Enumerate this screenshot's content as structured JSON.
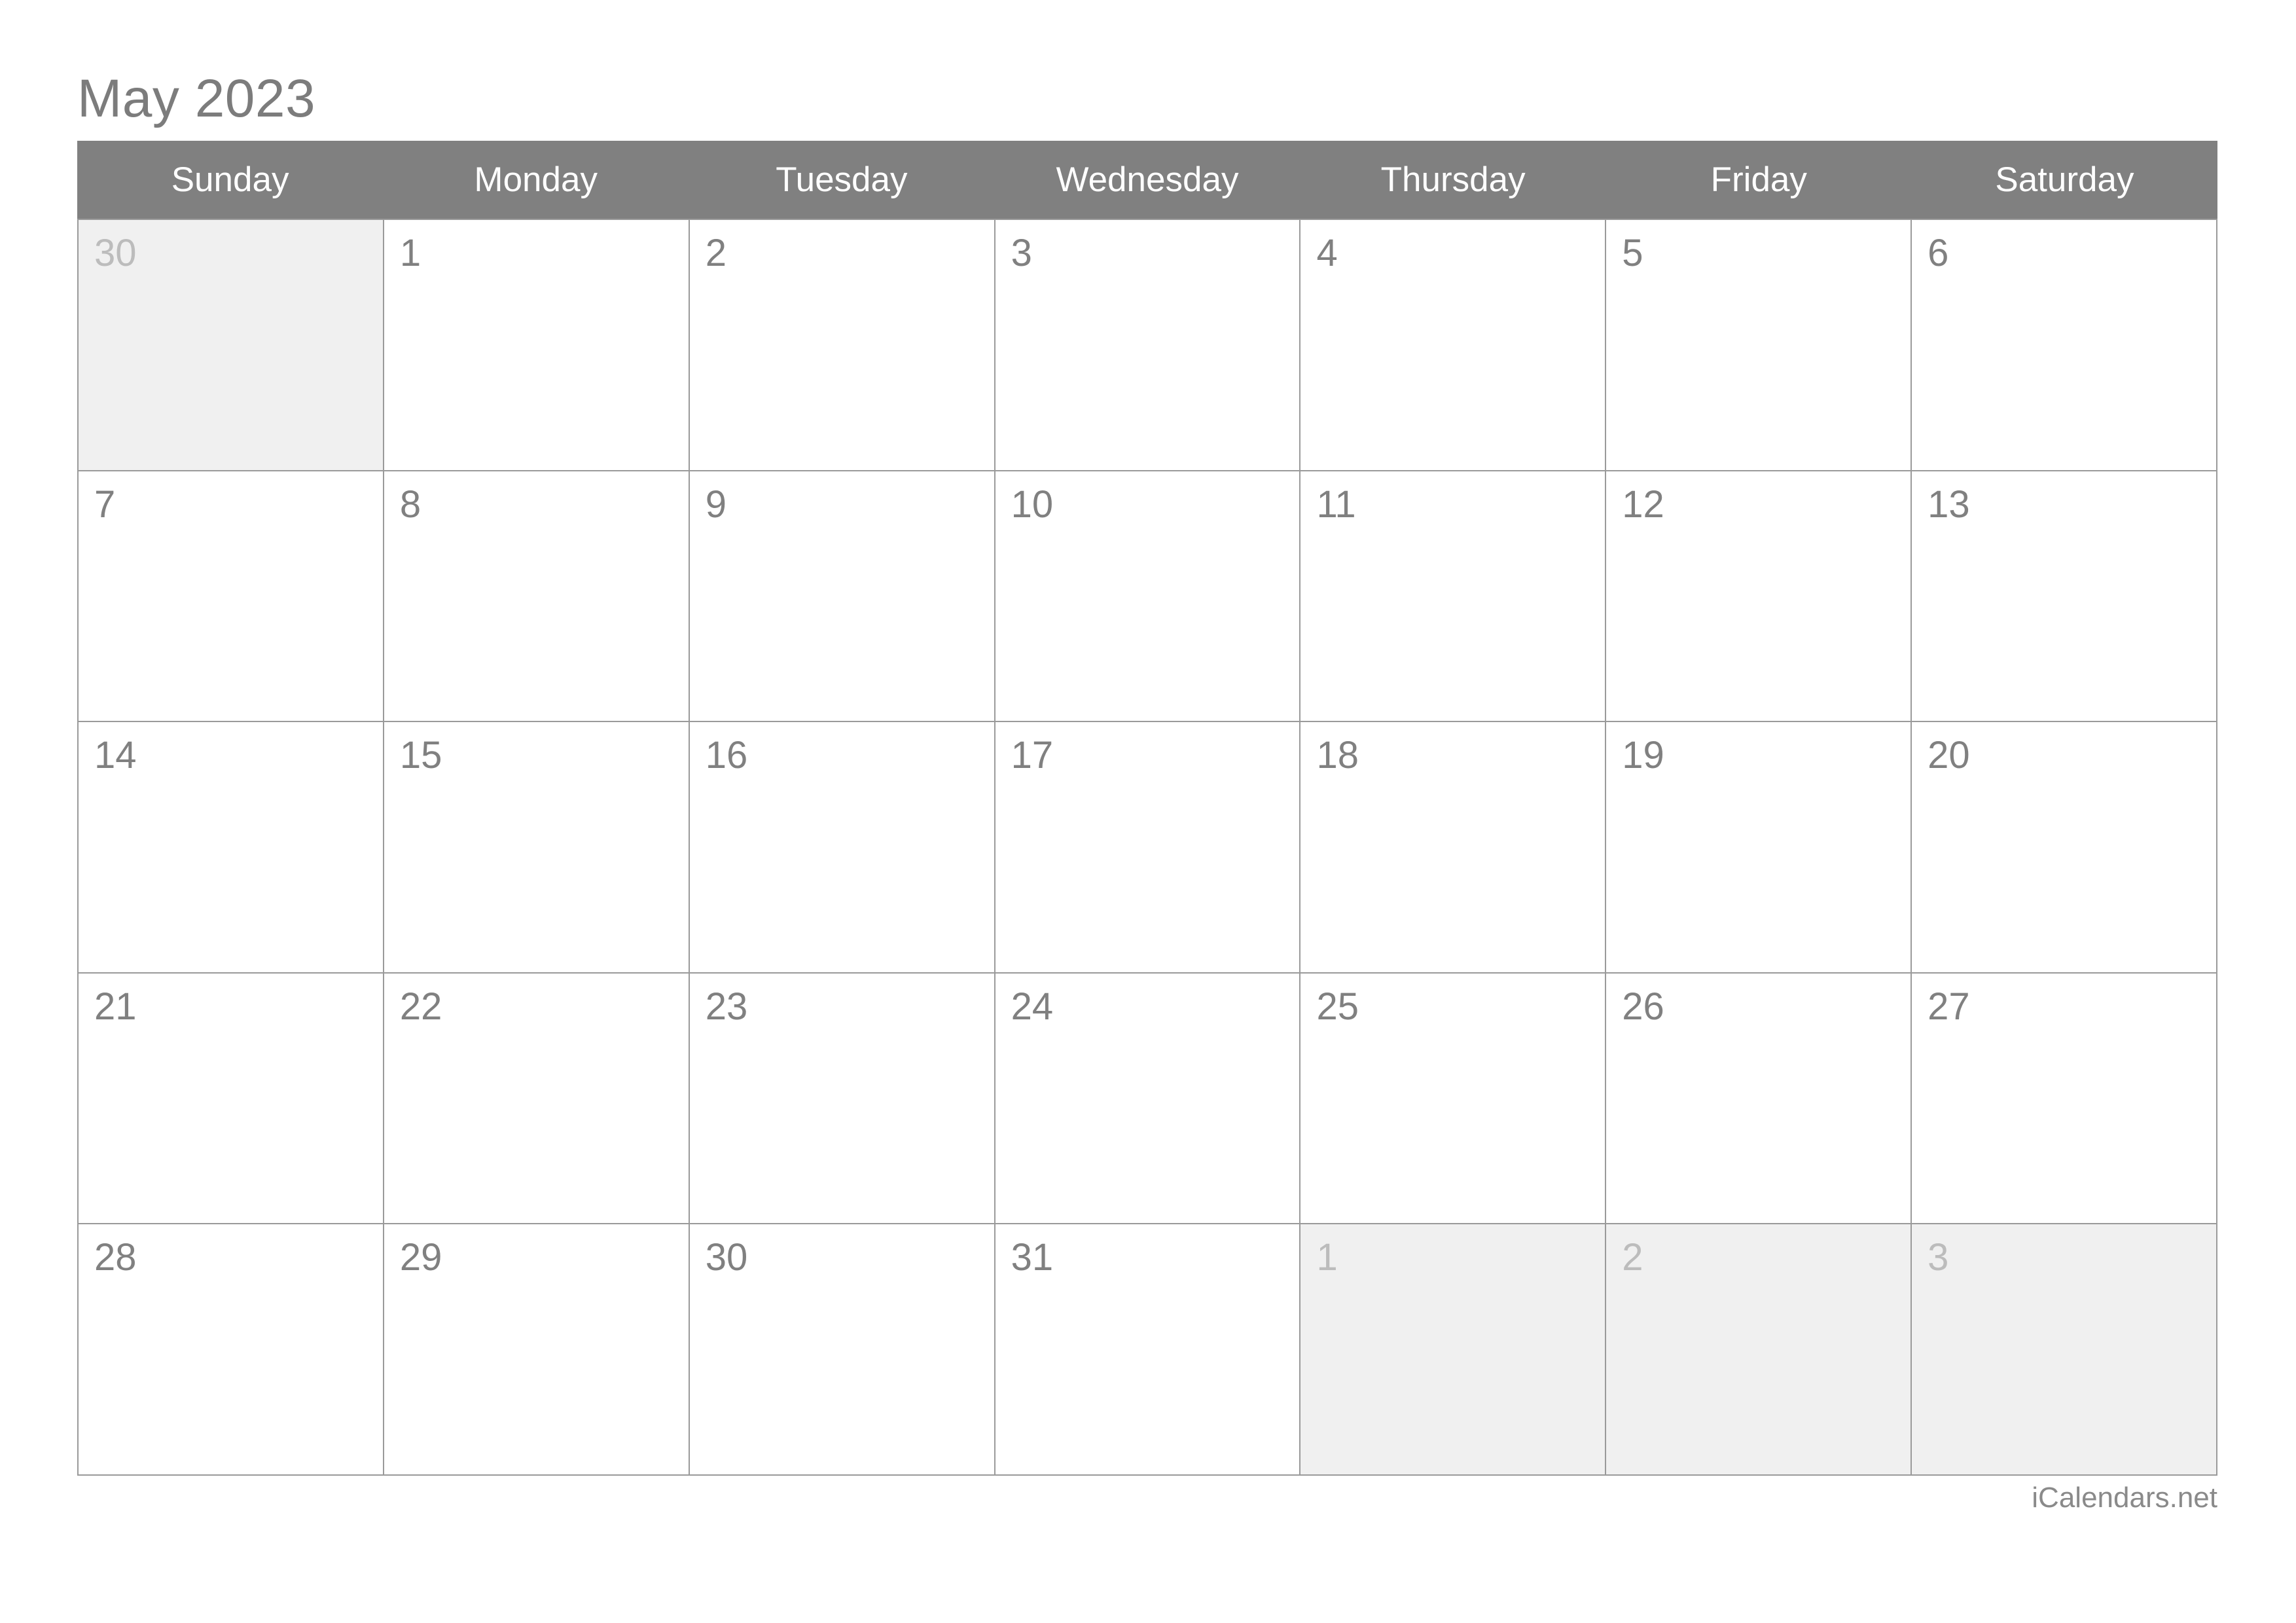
{
  "title": "May 2023",
  "month": "May",
  "year": "2023",
  "weekday_headers": [
    "Sunday",
    "Monday",
    "Tuesday",
    "Wednesday",
    "Thursday",
    "Friday",
    "Saturday"
  ],
  "watermark": "iCalendars.net",
  "colors": {
    "header_background": "#808080",
    "header_text": "#ffffff",
    "grid_border": "#9a9a9a",
    "cell_background": "#ffffff",
    "other_month_background": "#f0f0f0",
    "day_number": "#808080",
    "other_month_day_number": "#bcbcbc",
    "title_text": "#7c7c7c",
    "watermark_text": "#8a8a8a"
  },
  "weeks": [
    [
      {
        "day": "30",
        "other_month": true
      },
      {
        "day": "1",
        "other_month": false
      },
      {
        "day": "2",
        "other_month": false
      },
      {
        "day": "3",
        "other_month": false
      },
      {
        "day": "4",
        "other_month": false
      },
      {
        "day": "5",
        "other_month": false
      },
      {
        "day": "6",
        "other_month": false
      }
    ],
    [
      {
        "day": "7",
        "other_month": false
      },
      {
        "day": "8",
        "other_month": false
      },
      {
        "day": "9",
        "other_month": false
      },
      {
        "day": "10",
        "other_month": false
      },
      {
        "day": "11",
        "other_month": false
      },
      {
        "day": "12",
        "other_month": false
      },
      {
        "day": "13",
        "other_month": false
      }
    ],
    [
      {
        "day": "14",
        "other_month": false
      },
      {
        "day": "15",
        "other_month": false
      },
      {
        "day": "16",
        "other_month": false
      },
      {
        "day": "17",
        "other_month": false
      },
      {
        "day": "18",
        "other_month": false
      },
      {
        "day": "19",
        "other_month": false
      },
      {
        "day": "20",
        "other_month": false
      }
    ],
    [
      {
        "day": "21",
        "other_month": false
      },
      {
        "day": "22",
        "other_month": false
      },
      {
        "day": "23",
        "other_month": false
      },
      {
        "day": "24",
        "other_month": false
      },
      {
        "day": "25",
        "other_month": false
      },
      {
        "day": "26",
        "other_month": false
      },
      {
        "day": "27",
        "other_month": false
      }
    ],
    [
      {
        "day": "28",
        "other_month": false
      },
      {
        "day": "29",
        "other_month": false
      },
      {
        "day": "30",
        "other_month": false
      },
      {
        "day": "31",
        "other_month": false
      },
      {
        "day": "1",
        "other_month": true
      },
      {
        "day": "2",
        "other_month": true
      },
      {
        "day": "3",
        "other_month": true
      }
    ]
  ]
}
